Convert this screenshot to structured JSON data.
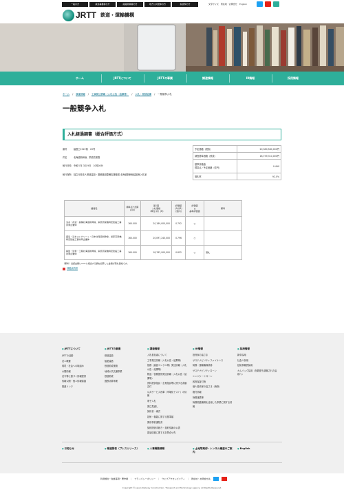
{
  "audience_tabs": [
    "一般の方",
    "鉄道事業者の方",
    "船舶関係者の方",
    "地方公共団体の方",
    "投資家の方"
  ],
  "utility": {
    "text_size": "文字サイズ",
    "lang_link": "所在地・お問合せ",
    "english": "English"
  },
  "colors": {
    "accent": "#2eaf9a",
    "twitter": "#1da1f2",
    "youtube": "#e62117",
    "search": "#2eaf9a"
  },
  "logo": {
    "text": "JRTT",
    "jp": "鉄道・運輸機構"
  },
  "nav": [
    "ホーム",
    "JRTTについて",
    "JRTTの事業",
    "調達情報",
    "IR情報",
    "採用情報"
  ],
  "breadcrumb": [
    "ホーム",
    "調達情報",
    "工事発注情報（入札公告・結果等）",
    "入札・見積結果",
    "一般競争入札"
  ],
  "page_title": "一般競争入札",
  "section_title": "入札経過調書（総合評価方式）",
  "info": [
    {
      "k": "番号",
      "v": "建遼工2022第　20号"
    },
    {
      "k": "件名",
      "v": "北海道新幹線、栄原高架橋"
    },
    {
      "k": "執行日時",
      "v": "令和５年 3月 9日　10時00分"
    },
    {
      "k": "執行場所",
      "v": "独立行政法人鉄道建設・運輸施設整備支援機構 北海道新幹線建設局入札室"
    }
  ],
  "summary": [
    {
      "k": "予定価格（税抜）",
      "v": "20,380,580,000円"
    },
    {
      "k": "調査基準価格（税抜）",
      "v": "18,759,310,000円"
    },
    {
      "k": "基準評価値\n標準点／予定価格（億円）",
      "v": "0.490"
    },
    {
      "k": "落札率",
      "v": "92.0%"
    }
  ],
  "bid_table": {
    "headers": [
      "業者名",
      "標準点+加算点(A)",
      "第1回\n入札価格\n（単位:円）(B)",
      "評価値\n(A)/(B)\n(億円)",
      "評価値\n≧\n基準評価値",
      "備考"
    ],
    "rows": [
      {
        "name": "清水・丹波・奥種北海道新幹線、栄原高架橋特定建設工事共同企業体",
        "score": "160.000",
        "price": "20,189,000,000",
        "eval": "0.792",
        "ok": "○",
        "note": ""
      },
      {
        "name": "鹿島・清水コンクリート・日本北海道新幹線、栄原高架橋特定建設工事共同企業体",
        "score": "160.000",
        "price": "20,097,240,000",
        "eval": "0.796",
        "ok": "○",
        "note": ""
      },
      {
        "name": "鉄建・建豊・工藤北海道新幹線、栄原高架橋特定建設工事共同企業体",
        "score": "160.000",
        "price": "18,762,900,000",
        "eval": "0.852",
        "ok": "○",
        "note": "落札"
      }
    ]
  },
  "note": "（備考）当該金額に10%に相当する額を加算した金額が落札価格です。",
  "pdf_link": "評価点内訳",
  "footer": {
    "cols": [
      {
        "h": "JRTTについて",
        "items": [
          "JRTTの活動",
          "法人概要",
          "環境・社会への取組み",
          "公開情報",
          "法令等に基づく情報提供",
          "情報公開・個人情報保護",
          "関連リンク"
        ]
      },
      {
        "h": "JRTTの事業",
        "items": [
          "鉄道建設",
          "船舶建造",
          "鉄道助成業務",
          "地域公共交通事業",
          "鉄道助成",
          "国鉄清算事業"
        ]
      },
      {
        "h": "調達情報",
        "items": [
          "入札参加者について",
          "工事発注情報（入札公告・結果等）",
          "役務（建設コンサル等）発注情報（入札公告・結果等）",
          "物品・役務提供発注情報（入札公告・結果等）",
          "資料提供招請・意見招請等に関する書類交付",
          "公共サービス改革（市場化テスト）の情報",
          "電子入札",
          "発注見通し",
          "契約書・様式",
          "技術・機能に関する基準類",
          "関係事前通知書",
          "契約関係手続き・契約情報の公表",
          "調達情報に関するお問合せ先"
        ]
      },
      {
        "h": "IR情報",
        "items": [
          "投資家の皆さま",
          "サステナビリティファイナンス",
          "財務・運輸機構債券",
          "サステナビリティローン",
          "シンジケートローン",
          "政府保証付債",
          "個人投資家の皆さま（債券）",
          "格付情報",
          "財務諸表等",
          "財務関連機構を活用した事業に関する情報"
        ]
      },
      {
        "h": "採用情報",
        "items": [
          "新卒採用",
          "社会人採用",
          "技術系職員採用",
          "カムバック採用（在籍歴も退職された皆様へ）"
        ]
      }
    ],
    "bottom": [
      "お知らせ",
      "報道発表（プレスリリース）",
      "人事異動情報",
      "土地等売却・トンネル譲渡のご案内",
      "English"
    ],
    "legal": [
      "利用規約・免責事項・著作権",
      "プライバシーポリシー",
      "ウェブアクセシビリティ",
      "所在地・お問合せ先"
    ],
    "copyright": "Copyright © Japan Railway Construction, Transport and Technology Agency. All Rights Reserved."
  }
}
